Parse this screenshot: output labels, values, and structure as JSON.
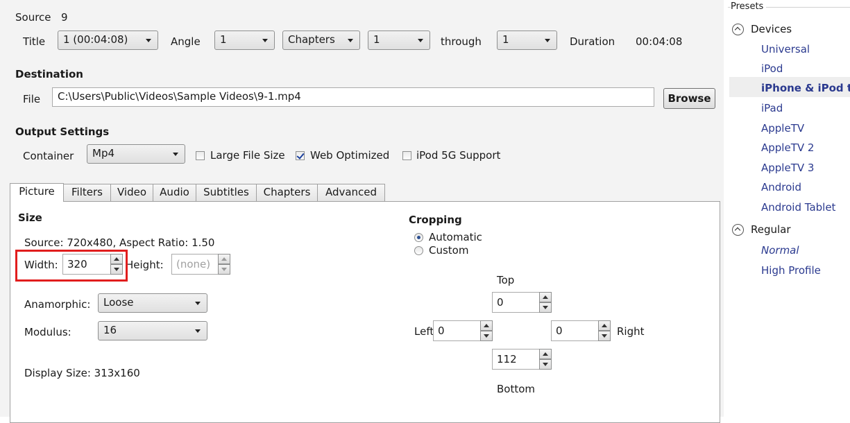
{
  "source": {
    "label": "Source",
    "value": "9"
  },
  "title_row": {
    "title_label": "Title",
    "title_value": "1 (00:04:08)",
    "angle_label": "Angle",
    "angle_value": "1",
    "range_mode": "Chapters",
    "range_start": "1",
    "through_label": "through",
    "range_end": "1",
    "duration_label": "Duration",
    "duration_value": "00:04:08"
  },
  "destination": {
    "heading": "Destination",
    "file_label": "File",
    "file_path": "C:\\Users\\Public\\Videos\\Sample Videos\\9-1.mp4",
    "browse_label": "Browse"
  },
  "output": {
    "heading": "Output Settings",
    "container_label": "Container",
    "container_value": "Mp4",
    "large_file_label": "Large File Size",
    "large_file_checked": false,
    "web_optimized_label": "Web Optimized",
    "web_optimized_checked": true,
    "ipod_label": "iPod 5G Support",
    "ipod_checked": false
  },
  "tabs": [
    {
      "label": "Picture",
      "active": true
    },
    {
      "label": "Filters",
      "active": false
    },
    {
      "label": "Video",
      "active": false
    },
    {
      "label": "Audio",
      "active": false
    },
    {
      "label": "Subtitles",
      "active": false
    },
    {
      "label": "Chapters",
      "active": false
    },
    {
      "label": "Advanced",
      "active": false
    }
  ],
  "picture": {
    "size_heading": "Size",
    "source_info": "Source:  720x480, Aspect Ratio: 1.50",
    "width_label": "Width:",
    "width_value": "320",
    "height_label": "Height:",
    "height_value": "(none)",
    "anamorphic_label": "Anamorphic:",
    "anamorphic_value": "Loose",
    "modulus_label": "Modulus:",
    "modulus_value": "16",
    "display_size": "Display Size:  313x160",
    "highlight_color": "#e11d1d"
  },
  "cropping": {
    "heading": "Cropping",
    "automatic_label": "Automatic",
    "custom_label": "Custom",
    "selected": "Automatic",
    "top_label": "Top",
    "top_value": "0",
    "left_label": "Left",
    "left_value": "0",
    "right_label": "Right",
    "right_value": "0",
    "bottom_label": "Bottom",
    "bottom_value": "112"
  },
  "presets": {
    "heading": "Presets",
    "groups": [
      {
        "name": "Devices",
        "items": [
          "Universal",
          "iPod",
          "iPhone & iPod t",
          "iPad",
          "AppleTV",
          "AppleTV 2",
          "AppleTV 3",
          "Android",
          "Android Tablet"
        ]
      },
      {
        "name": "Regular",
        "items": [
          "Normal",
          "High Profile"
        ]
      }
    ],
    "selected": "iPhone & iPod t",
    "item_color": "#2b3a8f"
  }
}
